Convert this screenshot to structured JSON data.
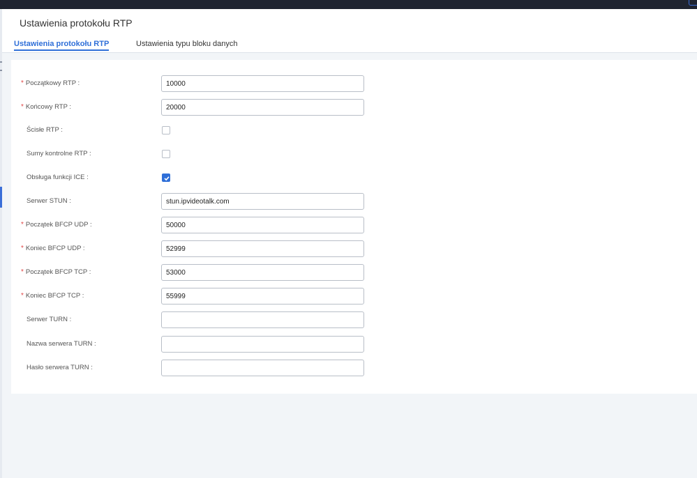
{
  "page": {
    "title": "Ustawienia protokołu RTP"
  },
  "tabs": [
    {
      "label": "Ustawienia protokołu RTP",
      "active": true
    },
    {
      "label": "Ustawienia typu bloku danych",
      "active": false
    }
  ],
  "form": {
    "fields": [
      {
        "label": "Początkowy RTP :",
        "required": true,
        "type": "text",
        "value": "10000"
      },
      {
        "label": "Końcowy RTP :",
        "required": true,
        "type": "text",
        "value": "20000"
      },
      {
        "label": "Ścisłe RTP :",
        "required": false,
        "type": "checkbox",
        "checked": false
      },
      {
        "label": "Sumy kontrolne RTP :",
        "required": false,
        "type": "checkbox",
        "checked": false
      },
      {
        "label": "Obsługa funkcji ICE :",
        "required": false,
        "type": "checkbox",
        "checked": true
      },
      {
        "label": "Serwer STUN :",
        "required": false,
        "type": "text",
        "value": "stun.ipvideotalk.com"
      },
      {
        "label": "Początek BFCP UDP :",
        "required": true,
        "type": "text",
        "value": "50000"
      },
      {
        "label": "Koniec BFCP UDP :",
        "required": true,
        "type": "text",
        "value": "52999"
      },
      {
        "label": "Początek BFCP TCP :",
        "required": true,
        "type": "text",
        "value": "53000"
      },
      {
        "label": "Koniec BFCP TCP :",
        "required": true,
        "type": "text",
        "value": "55999"
      },
      {
        "label": "Serwer TURN :",
        "required": false,
        "type": "text",
        "value": ""
      },
      {
        "label": "Nazwa serwera TURN :",
        "required": false,
        "type": "text",
        "value": ""
      },
      {
        "label": "Hasło serwera TURN :",
        "required": false,
        "type": "text",
        "value": ""
      }
    ],
    "required_marker": "*"
  },
  "colors": {
    "accent": "#2f6fd8",
    "required": "#e04848",
    "background": "#f2f5f8",
    "topbar": "#1f2430"
  }
}
